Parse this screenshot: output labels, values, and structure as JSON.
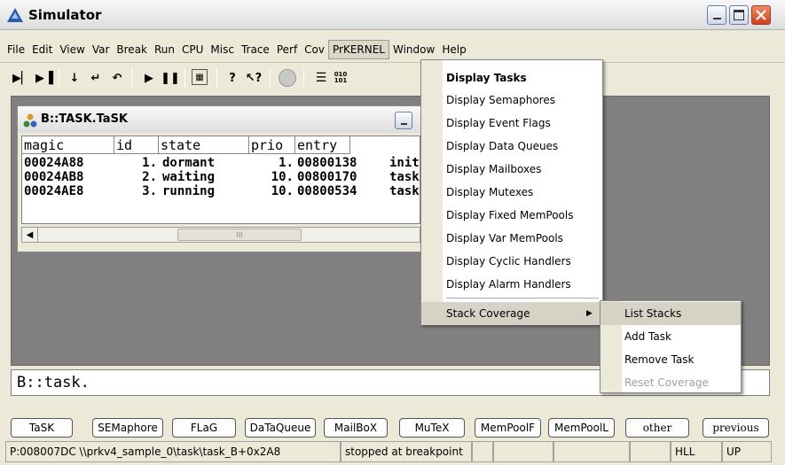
{
  "app": {
    "title": "Simulator"
  },
  "menubar": {
    "items": [
      "File",
      "Edit",
      "View",
      "Var",
      "Break",
      "Run",
      "CPU",
      "Misc",
      "Trace",
      "Perf",
      "Cov",
      "PrKERNEL",
      "Window",
      "Help"
    ],
    "active": "PrKERNEL"
  },
  "toolbar": {
    "icons": [
      "step-icon",
      "step-over-icon",
      "down-icon",
      "up-return-icon",
      "return-icon",
      "go-icon",
      "pause-icon",
      "register-view-icon",
      "help-icon",
      "context-help-icon",
      "stop-icon",
      "list-icon",
      "binary-icon"
    ]
  },
  "task_window": {
    "title": "B::TASK.TaSK",
    "columns": [
      "magic",
      "id",
      "state",
      "prio",
      "entry"
    ],
    "rows": [
      {
        "magic": "00024A88",
        "id": "1.",
        "state": "dormant",
        "prio": "1.",
        "entry": "00800138",
        "extra": "init"
      },
      {
        "magic": "00024AB8",
        "id": "2.",
        "state": "waiting",
        "prio": "10.",
        "entry": "00800170",
        "extra": "task"
      },
      {
        "magic": "00024AE8",
        "id": "3.",
        "state": "running",
        "prio": "10.",
        "entry": "00800534",
        "extra": "task"
      }
    ],
    "scroll_grip": "III"
  },
  "prkernel_menu": {
    "items": [
      "Display Tasks",
      "Display Semaphores",
      "Display Event Flags",
      "Display Data Queues",
      "Display Mailboxes",
      "Display Mutexes",
      "Display Fixed MemPools",
      "Display Var MemPools",
      "Display Cyclic Handlers",
      "Display Alarm Handlers"
    ],
    "stack_coverage": "Stack Coverage"
  },
  "stack_submenu": {
    "items": [
      "List Stacks",
      "Add Task",
      "Remove Task",
      "Reset Coverage"
    ]
  },
  "command_line": {
    "value": "B::task."
  },
  "softkeys": [
    "TaSK",
    "SEMaphore",
    "FLaG",
    "DaTaQueue",
    "MailBoX",
    "MuTeX",
    "MemPoolF",
    "MemPoolL",
    "other",
    "previous"
  ],
  "statusbar": {
    "address": "P:008007DC \\\\prkv4_sample_0\\task\\task_B+0x2A8",
    "state": "stopped at breakpoint",
    "mode": "HLL",
    "direction": "UP"
  },
  "colors": {
    "workspace": "#808080",
    "chrome": "#ece9d8",
    "close_button": "#c8421f"
  }
}
